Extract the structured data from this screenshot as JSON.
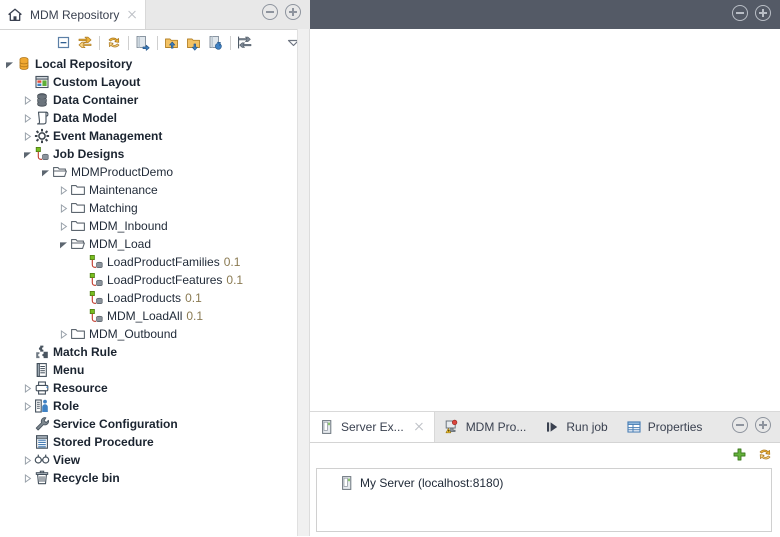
{
  "left_panel": {
    "tab": {
      "title": "MDM Repository",
      "icon": "home-icon",
      "close_icon": "close-icon"
    },
    "window_controls": {
      "minimize": "minimize-icon",
      "maximize": "maximize-icon"
    },
    "toolbar": [
      {
        "name": "collapse-all-icon",
        "tooltip": "Collapse All"
      },
      {
        "name": "link-with-editor-icon",
        "tooltip": "Link with Editor"
      },
      {
        "name": "refresh-icon",
        "tooltip": "Refresh"
      },
      {
        "name": "import-items-icon",
        "tooltip": "Import Items"
      },
      {
        "name": "export-items-icon",
        "tooltip": "Export Items"
      },
      {
        "name": "import-archive-icon",
        "tooltip": "Import Archive"
      },
      {
        "name": "export-archive-icon",
        "tooltip": "Export Archive"
      },
      {
        "name": "filter-icon",
        "tooltip": "Filter"
      },
      {
        "name": "view-menu-icon",
        "tooltip": "View Menu"
      }
    ],
    "tree": [
      {
        "label": "Local Repository",
        "icon": "repository-icon",
        "indent": 0,
        "arrow": "expanded",
        "bold": true
      },
      {
        "label": "Custom Layout",
        "icon": "custom-layout-icon",
        "indent": 1,
        "arrow": "none",
        "bold": true
      },
      {
        "label": "Data Container",
        "icon": "data-container-icon",
        "indent": 1,
        "arrow": "collapsed",
        "bold": true
      },
      {
        "label": "Data Model",
        "icon": "data-model-icon",
        "indent": 1,
        "arrow": "collapsed",
        "bold": true
      },
      {
        "label": "Event Management",
        "icon": "event-management-icon",
        "indent": 1,
        "arrow": "collapsed",
        "bold": true
      },
      {
        "label": "Job Designs",
        "icon": "job-designs-icon",
        "indent": 1,
        "arrow": "expanded",
        "bold": true
      },
      {
        "label": "MDMProductDemo",
        "icon": "folder-open-icon",
        "indent": 2,
        "arrow": "expanded",
        "bold": false
      },
      {
        "label": "Maintenance",
        "icon": "folder-icon",
        "indent": 3,
        "arrow": "collapsed",
        "bold": false
      },
      {
        "label": "Matching",
        "icon": "folder-icon",
        "indent": 3,
        "arrow": "collapsed",
        "bold": false
      },
      {
        "label": "MDM_Inbound",
        "icon": "folder-icon",
        "indent": 3,
        "arrow": "collapsed",
        "bold": false
      },
      {
        "label": "MDM_Load",
        "icon": "folder-open-icon",
        "indent": 3,
        "arrow": "expanded",
        "bold": false
      },
      {
        "label": "LoadProductFamilies",
        "version": "0.1",
        "icon": "job-icon",
        "indent": 4,
        "arrow": "none",
        "bold": false
      },
      {
        "label": "LoadProductFeatures",
        "version": "0.1",
        "icon": "job-icon",
        "indent": 4,
        "arrow": "none",
        "bold": false
      },
      {
        "label": "LoadProducts",
        "version": "0.1",
        "icon": "job-icon",
        "indent": 4,
        "arrow": "none",
        "bold": false
      },
      {
        "label": "MDM_LoadAll",
        "version": "0.1",
        "icon": "job-icon",
        "indent": 4,
        "arrow": "none",
        "bold": false
      },
      {
        "label": "MDM_Outbound",
        "icon": "folder-icon",
        "indent": 3,
        "arrow": "collapsed",
        "bold": false
      },
      {
        "label": "Match Rule",
        "icon": "match-rule-icon",
        "indent": 1,
        "arrow": "none",
        "bold": true
      },
      {
        "label": "Menu",
        "icon": "menu-icon",
        "indent": 1,
        "arrow": "none",
        "bold": true
      },
      {
        "label": "Resource",
        "icon": "resource-icon",
        "indent": 1,
        "arrow": "collapsed",
        "bold": true
      },
      {
        "label": "Role",
        "icon": "role-icon",
        "indent": 1,
        "arrow": "collapsed",
        "bold": true
      },
      {
        "label": "Service Configuration",
        "icon": "wrench-icon",
        "indent": 1,
        "arrow": "none",
        "bold": true
      },
      {
        "label": "Stored Procedure",
        "icon": "stored-procedure-icon",
        "indent": 1,
        "arrow": "none",
        "bold": true
      },
      {
        "label": "View",
        "icon": "view-icon",
        "indent": 1,
        "arrow": "collapsed",
        "bold": true
      },
      {
        "label": "Recycle bin",
        "icon": "recycle-bin-icon",
        "indent": 1,
        "arrow": "collapsed",
        "bold": true
      }
    ]
  },
  "editor_panel": {
    "window_controls": {
      "minimize": "minimize-icon",
      "maximize": "maximize-icon"
    }
  },
  "bottom_panel": {
    "tabs": [
      {
        "label": "Server Ex...",
        "icon": "server-icon",
        "active": true,
        "closable": true
      },
      {
        "label": "MDM Pro...",
        "icon": "mdm-problems-icon",
        "active": false,
        "closable": false
      },
      {
        "label": "Run job",
        "icon": "run-job-icon",
        "active": false,
        "closable": false
      },
      {
        "label": "Properties",
        "icon": "properties-icon",
        "active": false,
        "closable": false
      }
    ],
    "window_controls": {
      "minimize": "minimize-icon",
      "maximize": "maximize-icon"
    },
    "tools": [
      {
        "name": "add-server-icon",
        "tooltip": "Add"
      },
      {
        "name": "refresh-icon",
        "tooltip": "Refresh"
      }
    ],
    "servers": [
      {
        "label": "My Server (localhost:8180)",
        "icon": "server-icon"
      }
    ]
  },
  "colors": {
    "editor_header": "#545a66",
    "tabbar": "#e8e8e8",
    "version_text": "#8a7a52",
    "accent_orange": "#f0a830",
    "accent_green": "#7cb82f",
    "accent_blue": "#3f82c4"
  }
}
